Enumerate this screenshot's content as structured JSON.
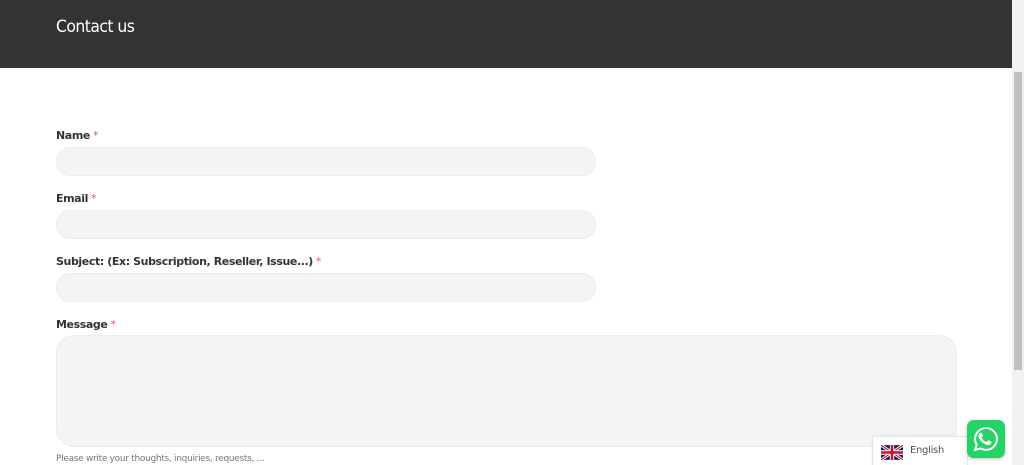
{
  "header": {
    "title": "Contact us"
  },
  "form": {
    "name": {
      "label": "Name",
      "required_mark": "*",
      "value": ""
    },
    "email": {
      "label": "Email",
      "required_mark": "*",
      "value": ""
    },
    "subject": {
      "label": "Subject: (Ex: Subscription, Reseller, Issue...)",
      "required_mark": "*",
      "value": ""
    },
    "message": {
      "label": "Message",
      "required_mark": "*",
      "value": "",
      "hint": "Please write your thoughts, inquiries, requests, ..."
    }
  },
  "language_switcher": {
    "label": "English",
    "flag_icon": "uk-flag-icon"
  },
  "whatsapp": {
    "icon": "whatsapp-icon",
    "color": "#25d366"
  },
  "colors": {
    "header_bg": "#333333",
    "required": "#e85858",
    "input_bg": "#f4f4f4"
  }
}
